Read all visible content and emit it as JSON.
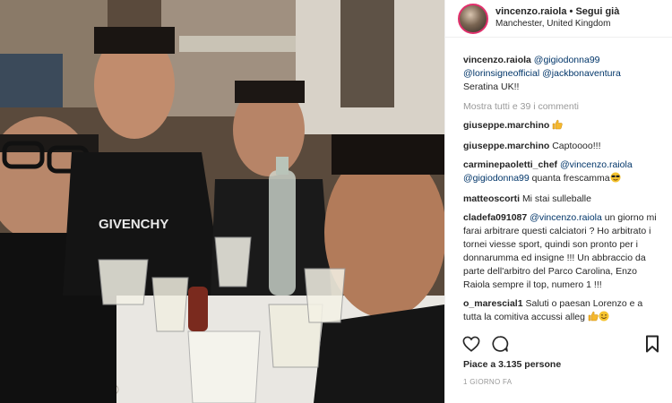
{
  "post": {
    "author": "vincenzo.raiola",
    "separator": " • ",
    "follow_state": "Segui già",
    "location": "Manchester, United Kingdom"
  },
  "caption": {
    "user": "vincenzo.raiola",
    "mentions": [
      "@gigiodonna99",
      "@lorinsigneofficial",
      "@jackbonaventura"
    ],
    "text": "Seratina UK!!"
  },
  "load_more": "Mostra tutti e 39 i commenti",
  "comments": [
    {
      "user": "giuseppe.marchino",
      "text": "",
      "emoji": "thumbs-up"
    },
    {
      "user": "giuseppe.marchino",
      "text": "Captoooo!!!"
    },
    {
      "user": "carminepaoletti_chef",
      "mentions": [
        "@vincenzo.raiola",
        "@gigiodonna99"
      ],
      "text": "quanta frescamma",
      "emoji": "sunglasses-face"
    },
    {
      "user": "matteoscorti",
      "text": "Mi stai sulleballe"
    },
    {
      "user": "cladefa091087",
      "mentions": [
        "@vincenzo.raiola"
      ],
      "text": "un giorno mi farai arbitrare questi calciatori ? Ho arbitrato i tornei viesse sport, quindi son pronto per i donnarumma ed insigne !!! Un abbraccio da parte dell'arbitro del Parco Carolina, Enzo Raiola sempre il top, numero 1 !!!"
    },
    {
      "user": "o_marescial1",
      "text": "Saluti o paesan Lorenzo e a tutta la comitiva accussi alleg",
      "emoji": "thumbs-up-smile"
    }
  ],
  "likes": "Piace a 3.135 persone",
  "time_ago": "1 GIORNO FA",
  "icons": {
    "like": "heart-icon",
    "comment": "comment-icon",
    "save": "bookmark-icon"
  }
}
